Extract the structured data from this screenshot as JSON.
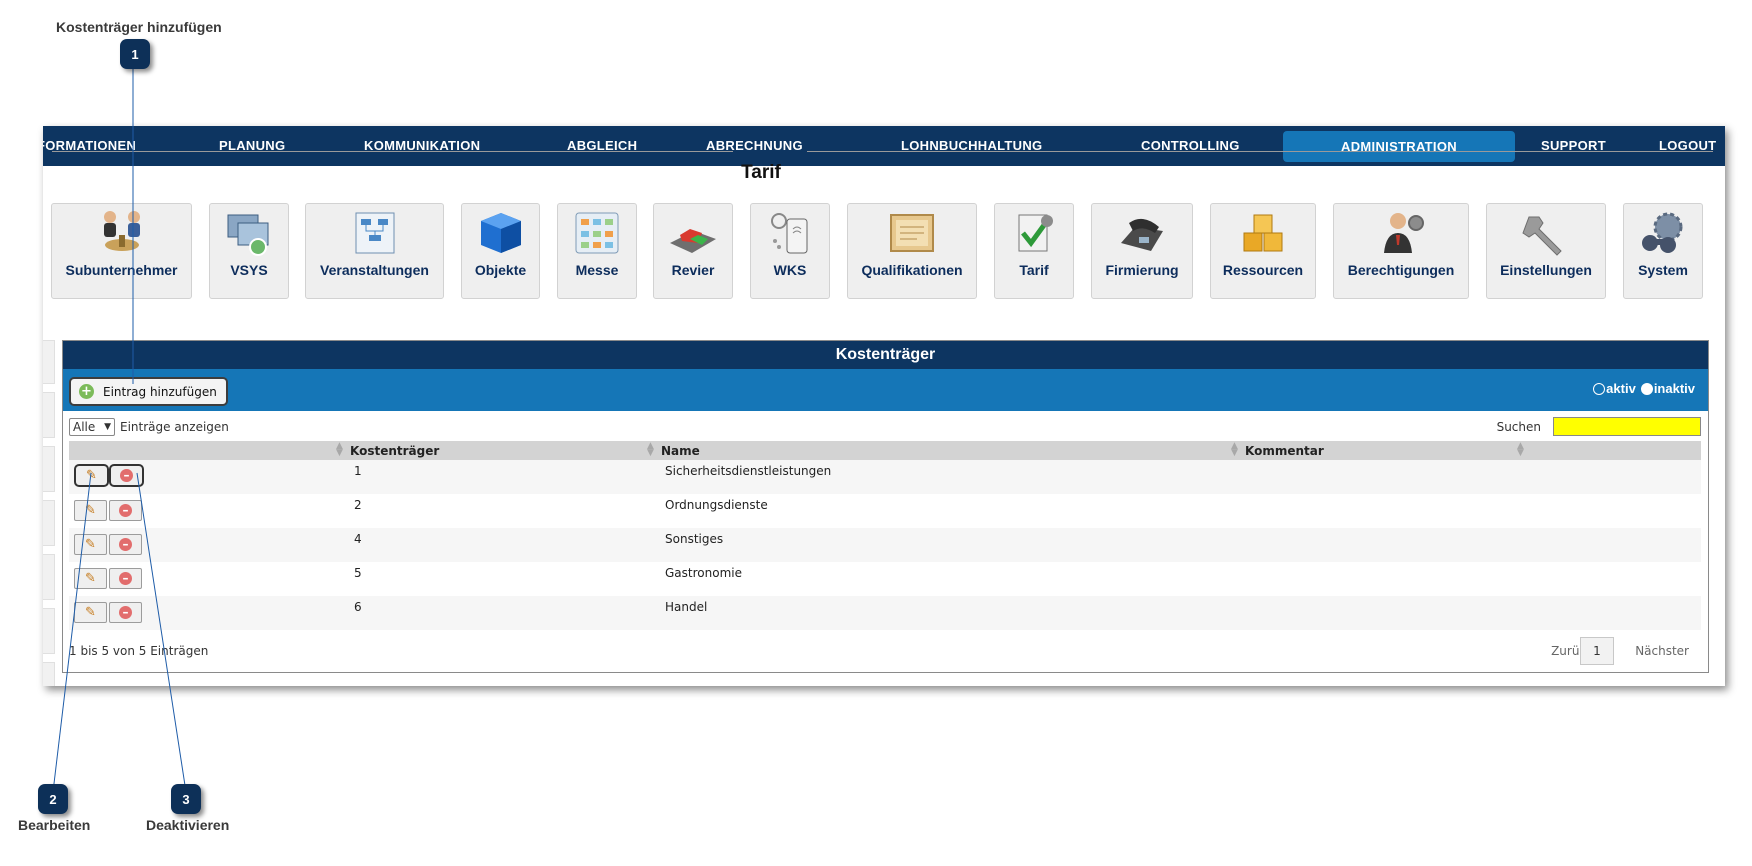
{
  "callouts": [
    {
      "num": "1",
      "label": "Kostenträger hinzufügen"
    },
    {
      "num": "2",
      "label": "Bearbeiten"
    },
    {
      "num": "3",
      "label": "Deaktivieren"
    }
  ],
  "nav": {
    "items": [
      {
        "label": "FORMATIONEN"
      },
      {
        "label": "PLANUNG"
      },
      {
        "label": "KOMMUNIKATION"
      },
      {
        "label": "ABGLEICH"
      },
      {
        "label": "ABRECHNUNG"
      },
      {
        "label": "LOHNBUCHHALTUNG"
      },
      {
        "label": "CONTROLLING"
      },
      {
        "label": "ADMINISTRATION"
      },
      {
        "label": "SUPPORT"
      },
      {
        "label": "LOGOUT"
      }
    ],
    "active": "ADMINISTRATION",
    "colors": {
      "bar": "#0d3561",
      "active": "#1576b7"
    }
  },
  "module": {
    "title": "Tarif"
  },
  "tiles": [
    {
      "label": "Subunternehmer",
      "icon": "handshake-icon"
    },
    {
      "label": "VSYS",
      "icon": "computer-network-icon"
    },
    {
      "label": "Veranstaltungen",
      "icon": "flowchart-icon"
    },
    {
      "label": "Objekte",
      "icon": "blue-cube-icon"
    },
    {
      "label": "Messe",
      "icon": "floor-plan-icon"
    },
    {
      "label": "Revier",
      "icon": "car-icon"
    },
    {
      "label": "WKS",
      "icon": "mobile-nfc-icon"
    },
    {
      "label": "Qualifikationen",
      "icon": "certificate-icon"
    },
    {
      "label": "Tarif",
      "icon": "tariff-check-icon"
    },
    {
      "label": "Firmierung",
      "icon": "telephone-icon"
    },
    {
      "label": "Ressourcen",
      "icon": "boxes-icon"
    },
    {
      "label": "Berechtigungen",
      "icon": "user-gear-icon"
    },
    {
      "label": "Einstellungen",
      "icon": "wrench-icon"
    },
    {
      "label": "System",
      "icon": "binoculars-gear-icon"
    }
  ],
  "panel": {
    "title": "Kostenträger",
    "add_label": "Eintrag hinzufügen",
    "filter": {
      "aktiv": "aktiv",
      "inaktiv": "inaktiv",
      "selected": "inaktiv"
    },
    "length": {
      "value": "Alle",
      "label": "Einträge anzeigen"
    },
    "search": {
      "label": "Suchen",
      "value": ""
    },
    "columns": [
      "Kostenträger",
      "Name",
      "Kommentar"
    ],
    "rows": [
      {
        "id": "1",
        "name": "Sicherheitsdienstleistungen",
        "comment": ""
      },
      {
        "id": "2",
        "name": "Ordnungsdienste",
        "comment": ""
      },
      {
        "id": "4",
        "name": "Sonstiges",
        "comment": ""
      },
      {
        "id": "5",
        "name": "Gastronomie",
        "comment": ""
      },
      {
        "id": "6",
        "name": "Handel",
        "comment": ""
      }
    ],
    "info": "1 bis 5 von 5 Einträgen",
    "pagination": {
      "prev": "Zurück",
      "page": "1",
      "next": "Nächster"
    }
  }
}
